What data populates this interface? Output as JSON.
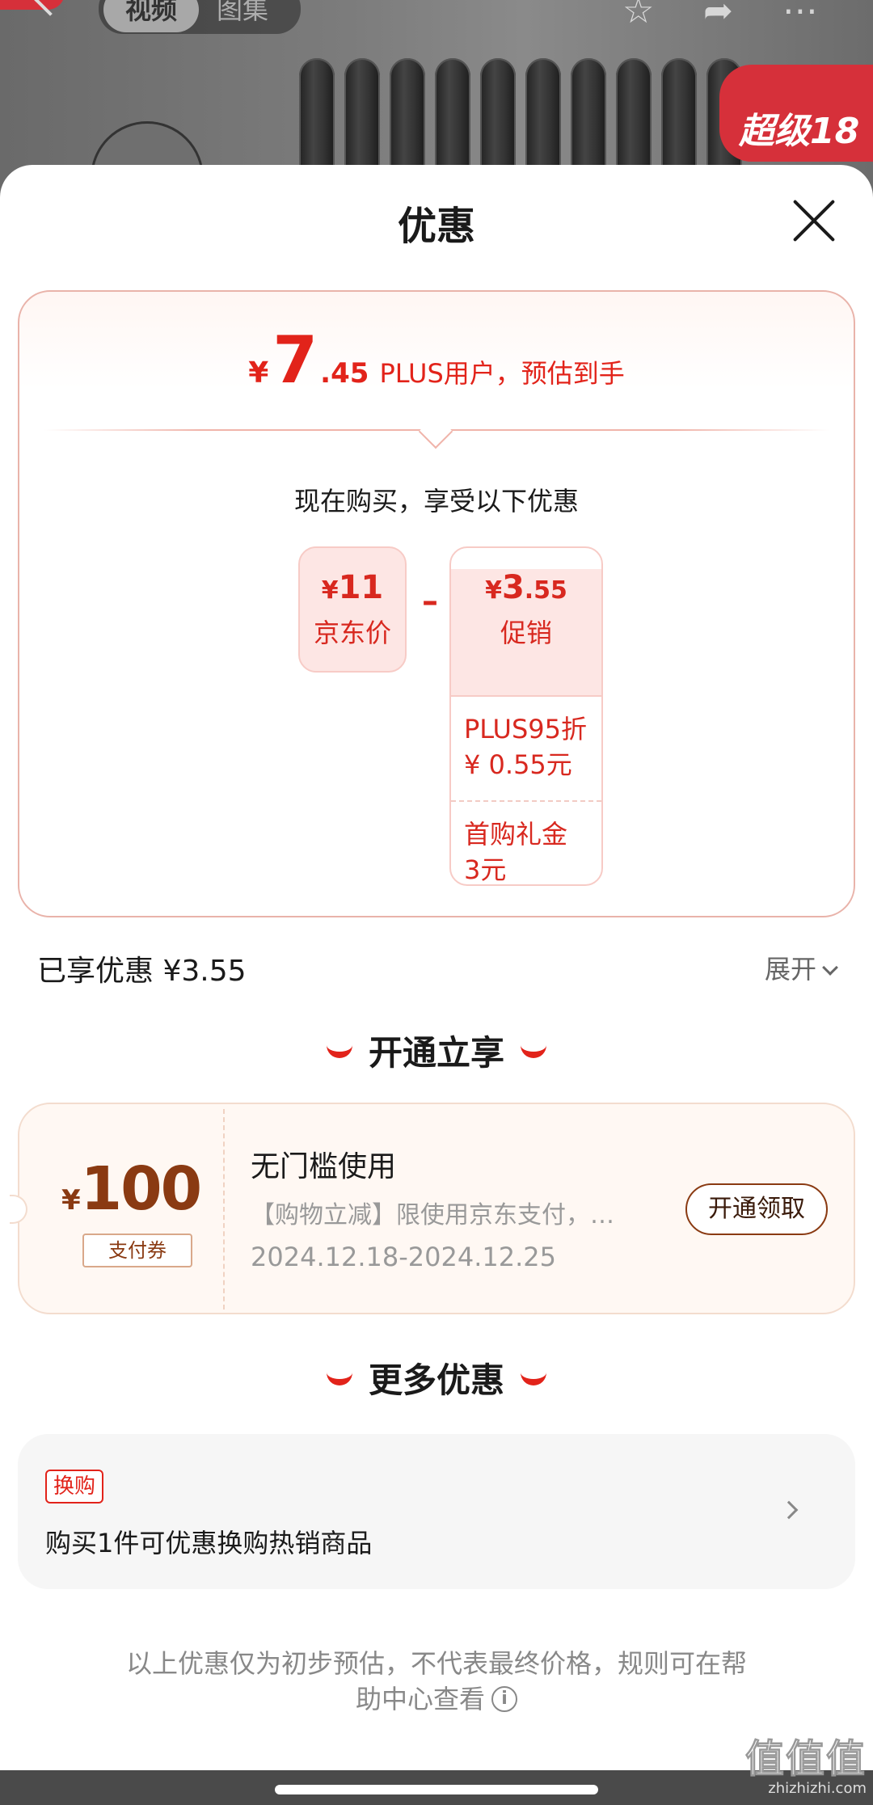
{
  "background": {
    "tab_video": "视频",
    "tab_album": "图集",
    "badge_text": "超级18"
  },
  "sheet": {
    "title": "优惠"
  },
  "estimate": {
    "symbol": "¥",
    "int": "7",
    "dec": ".45",
    "text": "PLUS用户，预估到手"
  },
  "breakdown": {
    "heading": "现在购买，享受以下优惠",
    "jd_price": {
      "symbol": "¥",
      "value": "11",
      "label": "京东价"
    },
    "minus": "–",
    "promo": {
      "symbol": "¥",
      "int": "3",
      "dec": ".55",
      "label": "促销",
      "details": [
        {
          "line1": "PLUS95折",
          "line2": "¥ 0.55元"
        },
        {
          "line1": "首购礼金",
          "line2": "3元"
        }
      ]
    }
  },
  "enjoyed": {
    "text": "已享优惠 ¥3.55",
    "expand_label": "展开"
  },
  "section_open": {
    "title": "开通立享"
  },
  "coupon": {
    "symbol": "¥",
    "amount": "100",
    "tag": "支付券",
    "title": "无门槛使用",
    "desc": "【购物立减】限使用京东支付，…",
    "date": "2024.12.18-2024.12.25",
    "button": "开通领取"
  },
  "section_more": {
    "title": "更多优惠"
  },
  "offer": {
    "tag": "换购",
    "text": "购买1件可优惠换购热销商品"
  },
  "disclaimer": {
    "line1": "以上优惠仅为初步预估，不代表最终价格，规则可在帮",
    "line2": "助中心查看",
    "info_icon": "i"
  },
  "watermark": {
    "glyph": "值值值",
    "url": "zhizhizhi.com"
  },
  "colors": {
    "accent_red": "#e2231a",
    "coupon_brown": "#8a3a12",
    "card_border": "#e9b3aa"
  }
}
